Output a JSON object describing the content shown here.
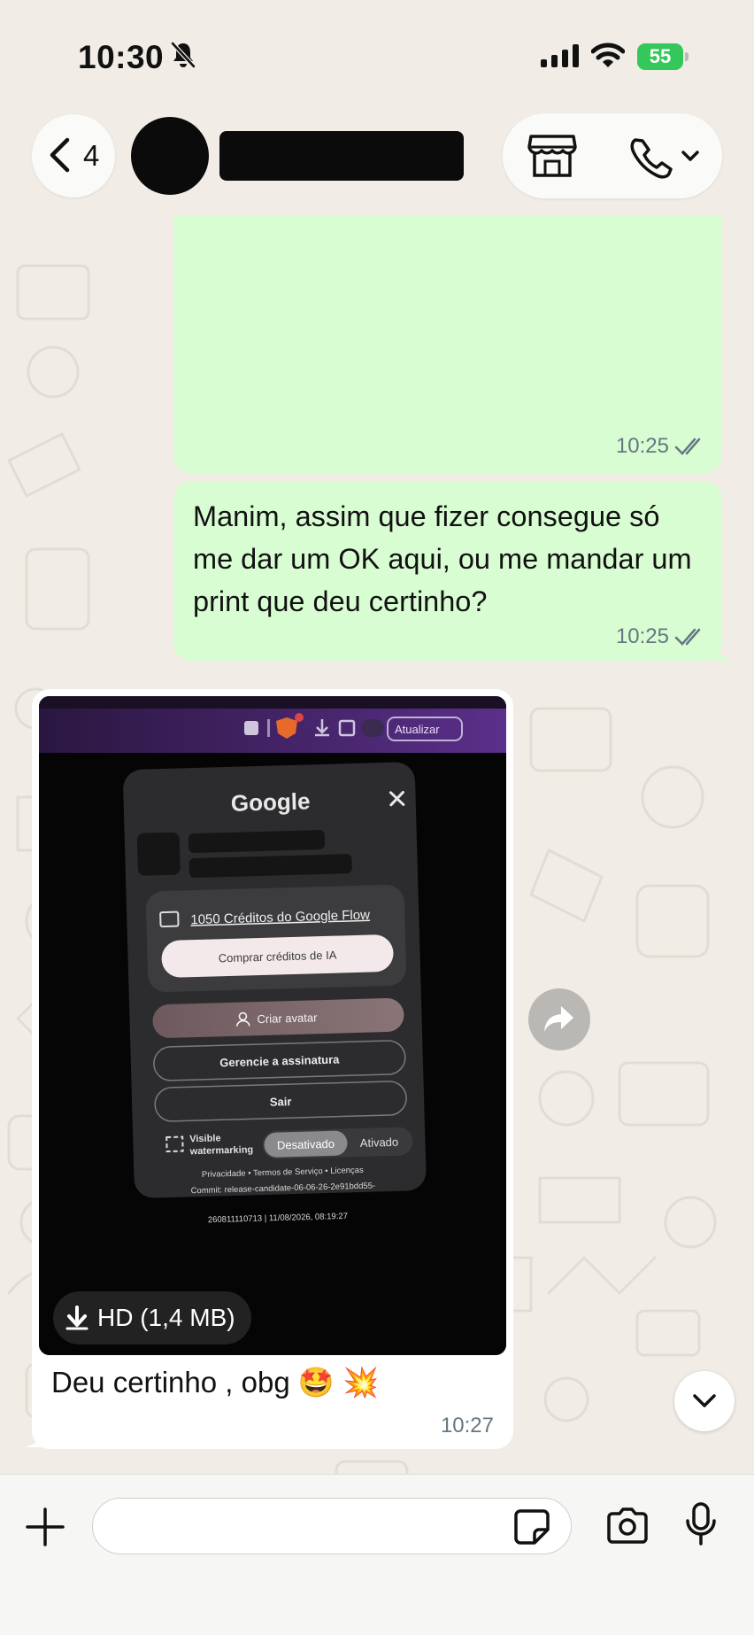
{
  "status_bar": {
    "time": "10:30",
    "battery": "55",
    "icons": [
      "bell-slash-icon",
      "cellular-signal-icon",
      "wifi-icon",
      "battery-charging-icon"
    ]
  },
  "header": {
    "back_count": "4",
    "contact_name": "",
    "icons": [
      "chevron-left-icon",
      "store-icon",
      "phone-icon",
      "chevron-down-icon"
    ]
  },
  "messages": [
    {
      "direction": "outgoing",
      "text": "",
      "time": "10:25",
      "status": "read-double-check"
    },
    {
      "direction": "outgoing",
      "text": "Manim, assim que fizer consegue só me dar um OK aqui, ou me mandar um print que deu certinho?",
      "time": "10:25",
      "status": "read-double-check"
    },
    {
      "direction": "incoming",
      "image": {
        "download_label": "HD (1,4 MB)",
        "screenshot": {
          "toolbar_button": "Atualizar",
          "brand": "Google",
          "credits_link": "1050 Créditos do Google Flow",
          "buy_button": "Comprar créditos de IA",
          "avatar_button": "Criar avatar",
          "manage_button": "Gerencie a assinatura",
          "signout_button": "Sair",
          "watermark_label_1": "Visible",
          "watermark_label_2": "watermarking",
          "toggle_off": "Desativado",
          "toggle_on": "Ativado",
          "footer_links": "Privacidade  •  Termos de Serviço  •  Licenças",
          "commit_line_1": "Commit: release-candidate-06-06-26-2e91bdd55-",
          "commit_line_2": "260811110713 | 11/08/2026, 08:19:27"
        }
      },
      "caption": "Deu certinho , obg 🤩 💥",
      "time": "10:27"
    }
  ],
  "input": {
    "placeholder": "",
    "value": "",
    "icons": [
      "plus-icon",
      "sticker-icon",
      "camera-icon",
      "microphone-icon"
    ]
  },
  "colors": {
    "outgoing_bubble": "#d9fdd3",
    "incoming_bubble": "#ffffff",
    "wallpaper": "#f1ede6",
    "battery": "#34c759",
    "timestamp": "#667781"
  }
}
